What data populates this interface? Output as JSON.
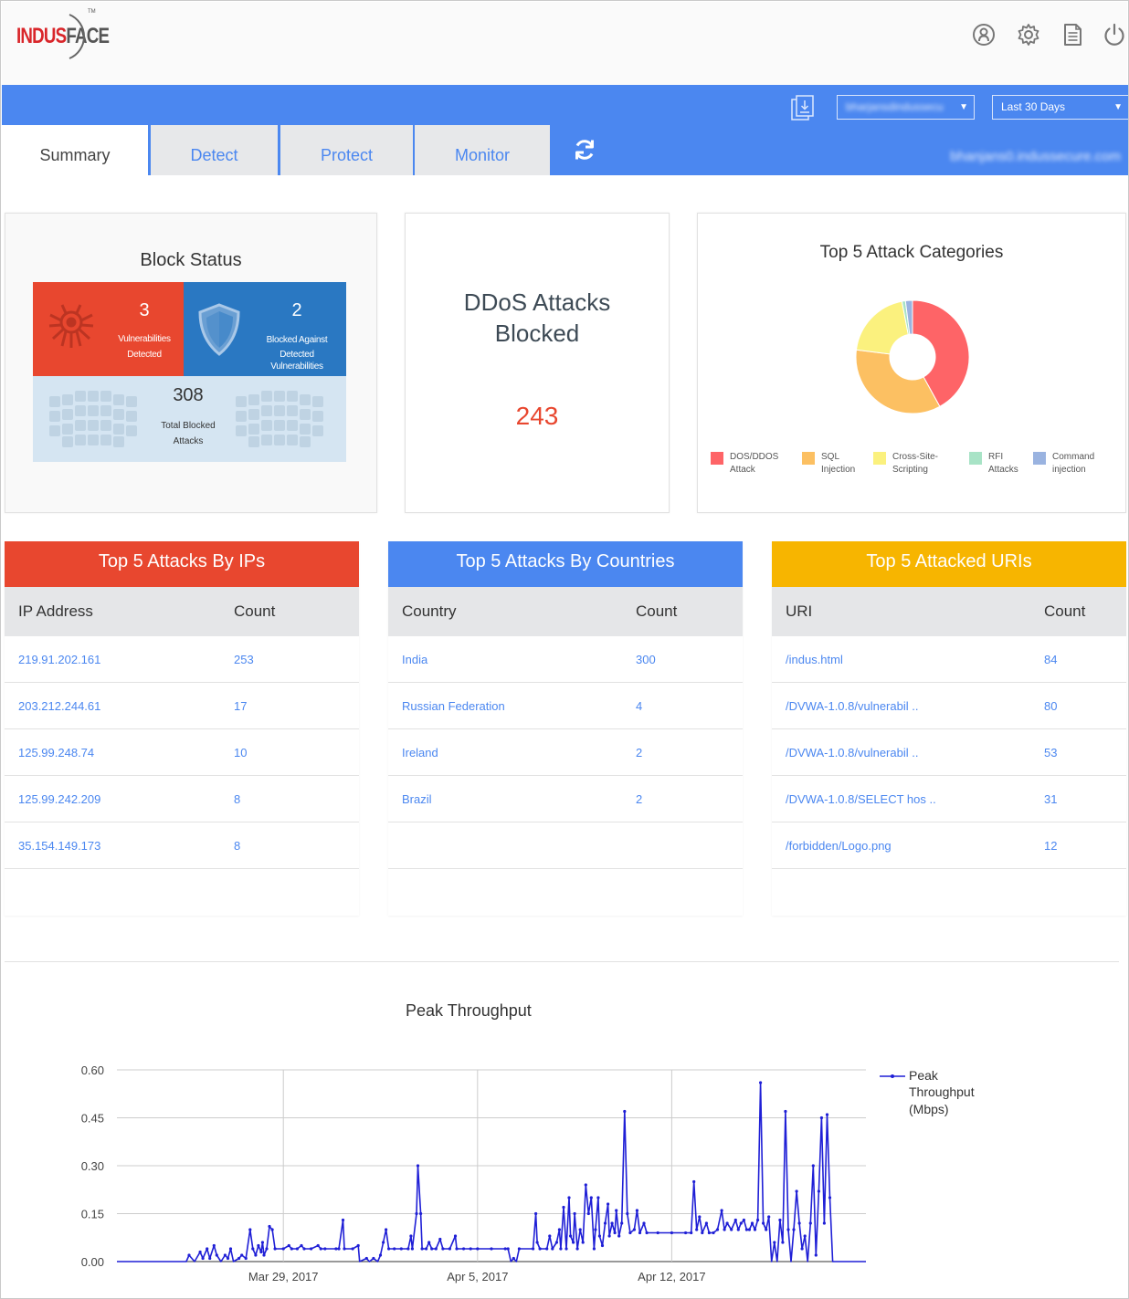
{
  "brand": {
    "logo_text_1": "INDUS",
    "logo_text_2": "FACE",
    "trademark": "TM"
  },
  "header_icons": [
    "user-icon",
    "gear-icon",
    "document-icon",
    "power-icon"
  ],
  "toolbar": {
    "account_select": "bharjansdindussecu",
    "range_select": "Last 30 Days",
    "host": "bhanjans0.indussecure.com"
  },
  "tabs": [
    {
      "label": "Summary",
      "active": true
    },
    {
      "label": "Detect",
      "active": false
    },
    {
      "label": "Protect",
      "active": false
    },
    {
      "label": "Monitor",
      "active": false
    }
  ],
  "block_status": {
    "title": "Block Status",
    "vulnerabilities": {
      "value": "3",
      "label_1": "Vulnerabilities",
      "label_2": "Detected"
    },
    "blocked": {
      "value": "2",
      "label_1": "Blocked Against",
      "label_2": "Detected",
      "label_3": "Vulnerabilities"
    },
    "total": {
      "value": "308",
      "label_1": "Total Blocked",
      "label_2": "Attacks"
    }
  },
  "ddos": {
    "title_1": "DDoS Attacks",
    "title_2": "Blocked",
    "value": "243"
  },
  "attack_categories": {
    "title": "Top 5 Attack Categories",
    "legend": [
      {
        "line1": "DOS/DDOS",
        "line2": "Attack",
        "color": "#fe6467"
      },
      {
        "line1": "SQL",
        "line2": "Injection",
        "color": "#fcc062"
      },
      {
        "line1": "Cross-Site-",
        "line2": "Scripting",
        "color": "#fbf17e"
      },
      {
        "line1": "RFI",
        "line2": "Attacks",
        "color": "#a8e3c6"
      },
      {
        "line1": "Command",
        "line2": "injection",
        "color": "#9ab3e0"
      }
    ]
  },
  "chart_data": [
    {
      "type": "pie",
      "title": "Top 5 Attack Categories",
      "categories": [
        "DOS/DDOS Attack",
        "SQL Injection",
        "Cross-Site-Scripting",
        "RFI Attacks",
        "Command injection"
      ],
      "values": [
        42,
        35,
        20,
        1,
        2
      ],
      "colors": [
        "#fe6467",
        "#fcc062",
        "#fbf17e",
        "#a8e3c6",
        "#9ab3e0"
      ]
    },
    {
      "type": "line",
      "title": "Peak Throughput",
      "x_ticks": [
        "Mar 29, 2017",
        "Apr 5, 2017",
        "Apr 12, 2017"
      ],
      "x_range": [
        "Mar 23, 2017",
        "Apr 21, 2017"
      ],
      "ylim": [
        0,
        0.6
      ],
      "y_ticks": [
        "0.60",
        "0.45",
        "0.30",
        "0.15",
        "0.00"
      ],
      "series": [
        {
          "name": "Peak Throughput (Mbps)",
          "color": "#1f1fd6",
          "points": [
            [
              0,
              0
            ],
            [
              5,
              0
            ],
            [
              5.2,
              0.02
            ],
            [
              5.6,
              0
            ],
            [
              6,
              0.03
            ],
            [
              6.2,
              0.01
            ],
            [
              6.5,
              0.04
            ],
            [
              6.7,
              0.01
            ],
            [
              7,
              0.05
            ],
            [
              7.2,
              0.02
            ],
            [
              7.5,
              0
            ],
            [
              7.8,
              0.02
            ],
            [
              8,
              0.01
            ],
            [
              8.2,
              0.04
            ],
            [
              8.4,
              0
            ],
            [
              8.8,
              0.01
            ],
            [
              9,
              0.02
            ],
            [
              9.3,
              0.01
            ],
            [
              9.6,
              0.1
            ],
            [
              9.8,
              0.04
            ],
            [
              10,
              0.02
            ],
            [
              10.2,
              0.05
            ],
            [
              10.4,
              0.03
            ],
            [
              10.5,
              0.06
            ],
            [
              10.6,
              0.02
            ],
            [
              10.8,
              0.04
            ],
            [
              11,
              0.11
            ],
            [
              11.2,
              0.1
            ],
            [
              11.4,
              0.04
            ],
            [
              12,
              0.04
            ],
            [
              12.4,
              0.05
            ],
            [
              12.6,
              0.04
            ],
            [
              13,
              0.04
            ],
            [
              13.3,
              0.05
            ],
            [
              13.5,
              0.04
            ],
            [
              14,
              0.04
            ],
            [
              14.5,
              0.05
            ],
            [
              14.7,
              0.04
            ],
            [
              15,
              0.04
            ],
            [
              15.8,
              0.04
            ],
            [
              16,
              0.04
            ],
            [
              16.3,
              0.13
            ],
            [
              16.4,
              0.04
            ],
            [
              17,
              0.04
            ],
            [
              17.4,
              0.05
            ],
            [
              17.5,
              0
            ],
            [
              18,
              0.01
            ],
            [
              18.2,
              0
            ],
            [
              18.5,
              0.01
            ],
            [
              18.8,
              0
            ],
            [
              19,
              0.02
            ],
            [
              19.2,
              0.06
            ],
            [
              19.4,
              0.1
            ],
            [
              19.6,
              0.04
            ],
            [
              20,
              0.04
            ],
            [
              20.5,
              0.04
            ],
            [
              21,
              0.04
            ],
            [
              21.2,
              0.08
            ],
            [
              21.3,
              0.04
            ],
            [
              21.6,
              0.15
            ],
            [
              21.7,
              0.3
            ],
            [
              21.9,
              0.15
            ],
            [
              22,
              0.04
            ],
            [
              22.3,
              0.04
            ],
            [
              22.5,
              0.06
            ],
            [
              22.7,
              0.04
            ],
            [
              23,
              0.04
            ],
            [
              23.3,
              0.07
            ],
            [
              23.5,
              0.04
            ],
            [
              24,
              0.04
            ],
            [
              24.4,
              0.08
            ],
            [
              24.5,
              0.04
            ],
            [
              25,
              0.04
            ],
            [
              25.5,
              0.04
            ],
            [
              26,
              0.04
            ],
            [
              27,
              0.04
            ],
            [
              28,
              0.04
            ],
            [
              28.2,
              0.04
            ],
            [
              28.4,
              0
            ],
            [
              28.6,
              0.01
            ],
            [
              28.8,
              0
            ],
            [
              29,
              0.04
            ],
            [
              30,
              0.04
            ],
            [
              30.2,
              0.15
            ],
            [
              30.3,
              0.06
            ],
            [
              30.5,
              0.04
            ],
            [
              31,
              0.04
            ],
            [
              31.2,
              0.08
            ],
            [
              31.4,
              0.04
            ],
            [
              31.7,
              0.06
            ],
            [
              31.9,
              0.1
            ],
            [
              32,
              0.04
            ],
            [
              32.2,
              0.17
            ],
            [
              32.4,
              0.04
            ],
            [
              32.6,
              0.2
            ],
            [
              32.7,
              0.08
            ],
            [
              32.9,
              0.06
            ],
            [
              33,
              0.15
            ],
            [
              33.2,
              0.04
            ],
            [
              33.4,
              0.1
            ],
            [
              33.6,
              0.06
            ],
            [
              33.8,
              0.24
            ],
            [
              34,
              0.15
            ],
            [
              34.2,
              0.2
            ],
            [
              34.4,
              0.04
            ],
            [
              34.5,
              0.1
            ],
            [
              34.7,
              0.2
            ],
            [
              34.8,
              0.08
            ],
            [
              35,
              0.05
            ],
            [
              35.2,
              0.12
            ],
            [
              35.4,
              0.18
            ],
            [
              35.5,
              0.08
            ],
            [
              35.7,
              0.12
            ],
            [
              35.9,
              0.09
            ],
            [
              36,
              0.16
            ],
            [
              36.2,
              0.08
            ],
            [
              36.4,
              0.12
            ],
            [
              36.6,
              0.47
            ],
            [
              36.8,
              0.15
            ],
            [
              37,
              0.09
            ],
            [
              37.3,
              0.1
            ],
            [
              37.5,
              0.16
            ],
            [
              37.7,
              0.09
            ],
            [
              38,
              0.12
            ],
            [
              38.2,
              0.09
            ],
            [
              39,
              0.09
            ],
            [
              40,
              0.09
            ],
            [
              41,
              0.09
            ],
            [
              41.4,
              0.09
            ],
            [
              41.6,
              0.25
            ],
            [
              41.8,
              0.1
            ],
            [
              42,
              0.14
            ],
            [
              42.2,
              0.09
            ],
            [
              42.5,
              0.12
            ],
            [
              42.7,
              0.09
            ],
            [
              43,
              0.09
            ],
            [
              43.3,
              0.1
            ],
            [
              43.6,
              0.16
            ],
            [
              43.8,
              0.1
            ],
            [
              44,
              0.12
            ],
            [
              44.3,
              0.1
            ],
            [
              44.6,
              0.13
            ],
            [
              44.8,
              0.1
            ],
            [
              45,
              0.12
            ],
            [
              45.2,
              0.13
            ],
            [
              45.4,
              0.1
            ],
            [
              45.6,
              0.1
            ],
            [
              45.8,
              0.12
            ],
            [
              46,
              0.1
            ],
            [
              46.2,
              0.13
            ],
            [
              46.4,
              0.56
            ],
            [
              46.6,
              0.12
            ],
            [
              46.8,
              0.1
            ],
            [
              47,
              0.14
            ],
            [
              47.2,
              0
            ],
            [
              47.4,
              0.06
            ],
            [
              47.6,
              0
            ],
            [
              47.8,
              0.13
            ],
            [
              48,
              0.06
            ],
            [
              48.2,
              0.47
            ],
            [
              48.4,
              0.1
            ],
            [
              48.6,
              0
            ],
            [
              48.8,
              0.1
            ],
            [
              49,
              0.22
            ],
            [
              49.2,
              0.12
            ],
            [
              49.4,
              0.04
            ],
            [
              49.6,
              0.08
            ],
            [
              49.8,
              0
            ],
            [
              50,
              0.12
            ],
            [
              50.2,
              0.3
            ],
            [
              50.4,
              0.02
            ],
            [
              50.6,
              0.22
            ],
            [
              50.8,
              0.45
            ],
            [
              51,
              0.12
            ],
            [
              51.2,
              0.46
            ],
            [
              51.4,
              0.2
            ],
            [
              51.6,
              0
            ],
            [
              52.5,
              0
            ],
            [
              54,
              0
            ]
          ]
        }
      ]
    }
  ],
  "top_ips": {
    "title": "Top 5 Attacks By IPs",
    "col1": "IP Address",
    "col2": "Count",
    "rows": [
      {
        "a": "219.91.202.161",
        "b": "253"
      },
      {
        "a": "203.212.244.61",
        "b": "17"
      },
      {
        "a": "125.99.248.74",
        "b": "10"
      },
      {
        "a": "125.99.242.209",
        "b": "8"
      },
      {
        "a": "35.154.149.173",
        "b": "8"
      }
    ]
  },
  "top_countries": {
    "title": "Top 5 Attacks By Countries",
    "col1": "Country",
    "col2": "Count",
    "rows": [
      {
        "a": "India",
        "b": "300"
      },
      {
        "a": "Russian Federation",
        "b": "4"
      },
      {
        "a": "Ireland",
        "b": "2"
      },
      {
        "a": "Brazil",
        "b": "2"
      }
    ]
  },
  "top_uris": {
    "title": "Top 5 Attacked URIs",
    "col1": "URI",
    "col2": "Count",
    "rows": [
      {
        "a": "/indus.html",
        "b": "84"
      },
      {
        "a": "/DVWA-1.0.8/vulnerabil ..",
        "b": "80"
      },
      {
        "a": "/DVWA-1.0.8/vulnerabil ..",
        "b": "53"
      },
      {
        "a": "/DVWA-1.0.8/SELECT hos ..",
        "b": "31"
      },
      {
        "a": "/forbidden/Logo.png",
        "b": "12"
      }
    ]
  },
  "throughput": {
    "title": "Peak Throughput",
    "legend_1": "Peak",
    "legend_2": "Throughput",
    "legend_3": "(Mbps)"
  }
}
